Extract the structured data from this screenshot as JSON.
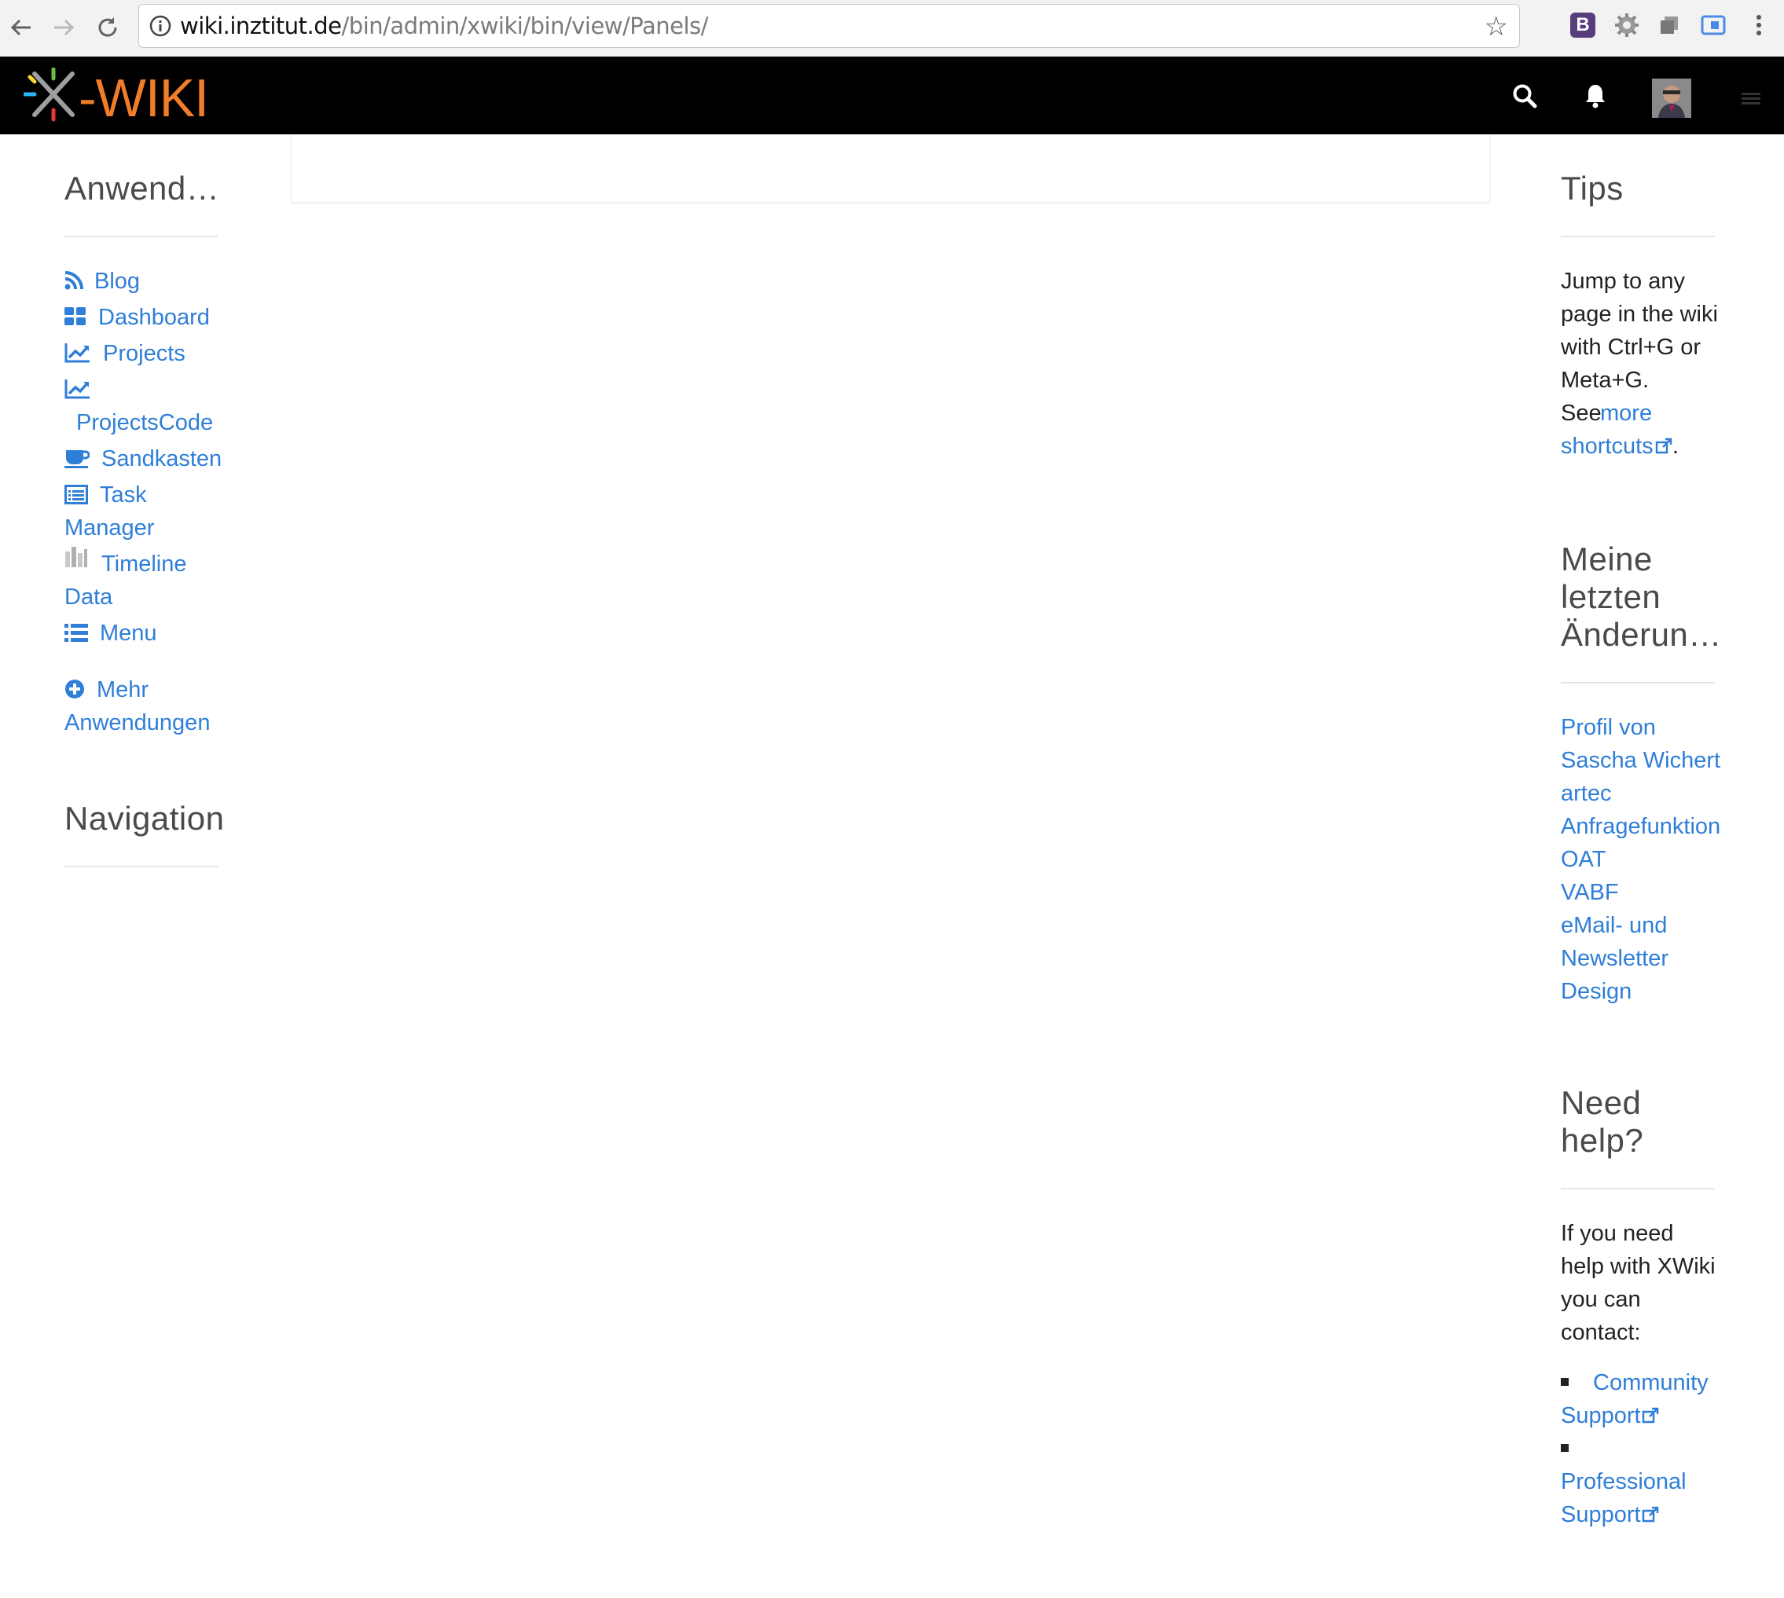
{
  "browser": {
    "url_host": "wiki.inztitut.de",
    "url_path": "/bin/admin/xwiki/bin/view/Panels/",
    "icons": [
      "back-icon",
      "forward-icon",
      "reload-icon",
      "info-icon",
      "bookmark-star-icon"
    ],
    "extensions": [
      "bootstrap-extension-icon",
      "gear-extension-icon",
      "window-extension-icon",
      "screen-extension-icon",
      "menu-dots-icon"
    ],
    "extension_label_b": "B"
  },
  "header": {
    "logo_text": "X-WIKI",
    "icons": [
      "search-icon",
      "bell-icon",
      "avatar",
      "drawer-icon"
    ]
  },
  "left": {
    "apps_title": "Anwend…",
    "apps": [
      {
        "label": "Blog",
        "icon": "rss-icon"
      },
      {
        "label": "Dashboard",
        "icon": "dashboard-grid-icon"
      },
      {
        "label": "Projects",
        "icon": "line-chart-icon"
      },
      {
        "label": "ProjectsCode",
        "icon": "line-chart-icon"
      },
      {
        "label": "Sandkasten",
        "icon": "cup-icon"
      },
      {
        "label_1": "Task",
        "label_2": "Manager",
        "icon": "list-box-icon"
      },
      {
        "label_1": "Timeline",
        "label_2": "Data",
        "icon": "timeline-icon"
      },
      {
        "label": "Menu",
        "icon": "list-icon"
      }
    ],
    "more_1": "Mehr",
    "more_2": "Anwendungen",
    "navigation_title": "Navigation"
  },
  "right": {
    "tips_title": "Tips",
    "tips_lines": [
      "Jump to any",
      "page in the wiki",
      "with Ctrl+G or",
      "Meta+G."
    ],
    "tips_see": "See",
    "tips_link_1": "more",
    "tips_link_2": "shortcuts",
    "tips_period": ".",
    "changes_title_lines": [
      "Meine",
      "letzten",
      "Änderun…"
    ],
    "changes_lines": [
      "Profil von",
      "Sascha Wichert",
      "artec",
      "Anfragefunktion",
      "OAT",
      "VABF",
      "eMail- und",
      "Newsletter",
      "Design"
    ],
    "help_title_lines": [
      "Need",
      "help?"
    ],
    "help_lines": [
      "If you need",
      "help with XWiki",
      "you can",
      "contact:"
    ],
    "support_1_a": "Community",
    "support_1_b": "Support",
    "support_2_a": "Professional",
    "support_2_b": "Support"
  },
  "colors": {
    "link": "#2f7ed8",
    "header_bg": "#000000",
    "logo_orange": "#f07d2a"
  }
}
